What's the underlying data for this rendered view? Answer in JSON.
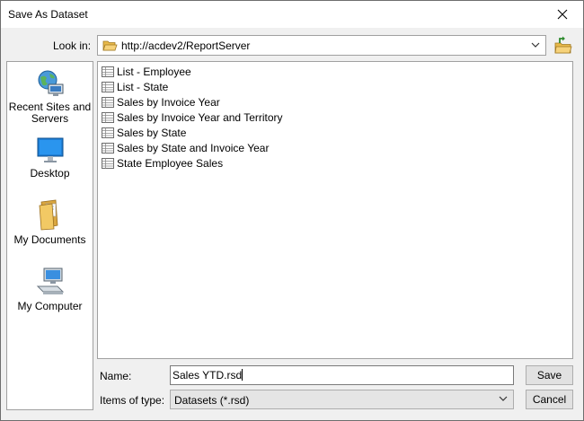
{
  "window": {
    "title": "Save As Dataset",
    "close_icon": "close-icon"
  },
  "lookin": {
    "label": "Look in:",
    "value": "http://acdev2/ReportServer"
  },
  "places": [
    {
      "label": "Recent Sites and Servers",
      "icon": "globe-computer-icon"
    },
    {
      "label": "Desktop",
      "icon": "desktop-icon"
    },
    {
      "label": "My Documents",
      "icon": "documents-folder-icon"
    },
    {
      "label": "My Computer",
      "icon": "computer-icon"
    }
  ],
  "files": [
    "List - Employee",
    "List - State",
    "Sales by Invoice Year",
    "Sales by Invoice Year and Territory",
    "Sales by State",
    "Sales by State and Invoice Year",
    "State Employee Sales"
  ],
  "name": {
    "label": "Name:",
    "value": "Sales YTD.rsd"
  },
  "type": {
    "label": "Items of type:",
    "value": "Datasets (*.rsd)"
  },
  "buttons": {
    "save": "Save",
    "cancel": "Cancel"
  }
}
